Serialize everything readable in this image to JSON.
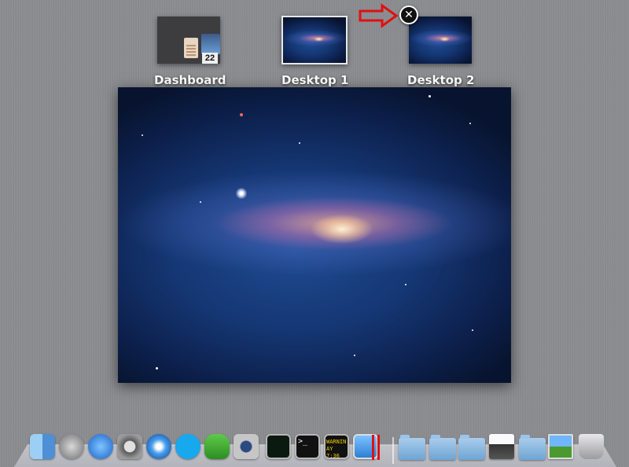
{
  "spaces": [
    {
      "label": "Dashboard",
      "calendar_day": "22"
    },
    {
      "label": "Desktop 1"
    },
    {
      "label": "Desktop 2"
    }
  ],
  "close_button": {
    "glyph": "✕"
  },
  "annotation": {
    "arrow_color": "#e01010"
  },
  "terminal_prompt": ">_",
  "console_lines": [
    "WARNIN",
    "AY 7:36"
  ],
  "dock": {
    "apps": [
      "Finder",
      "Launchpad",
      "App Store",
      "System Preferences",
      "Safari",
      "Skype",
      "Adium",
      "FaceTime",
      "Activity Monitor",
      "Terminal",
      "Console",
      "Preview"
    ],
    "folders": [
      "Applications",
      "Documents",
      "Downloads",
      "Printer",
      "Folder",
      "Photos",
      "Trash"
    ]
  }
}
